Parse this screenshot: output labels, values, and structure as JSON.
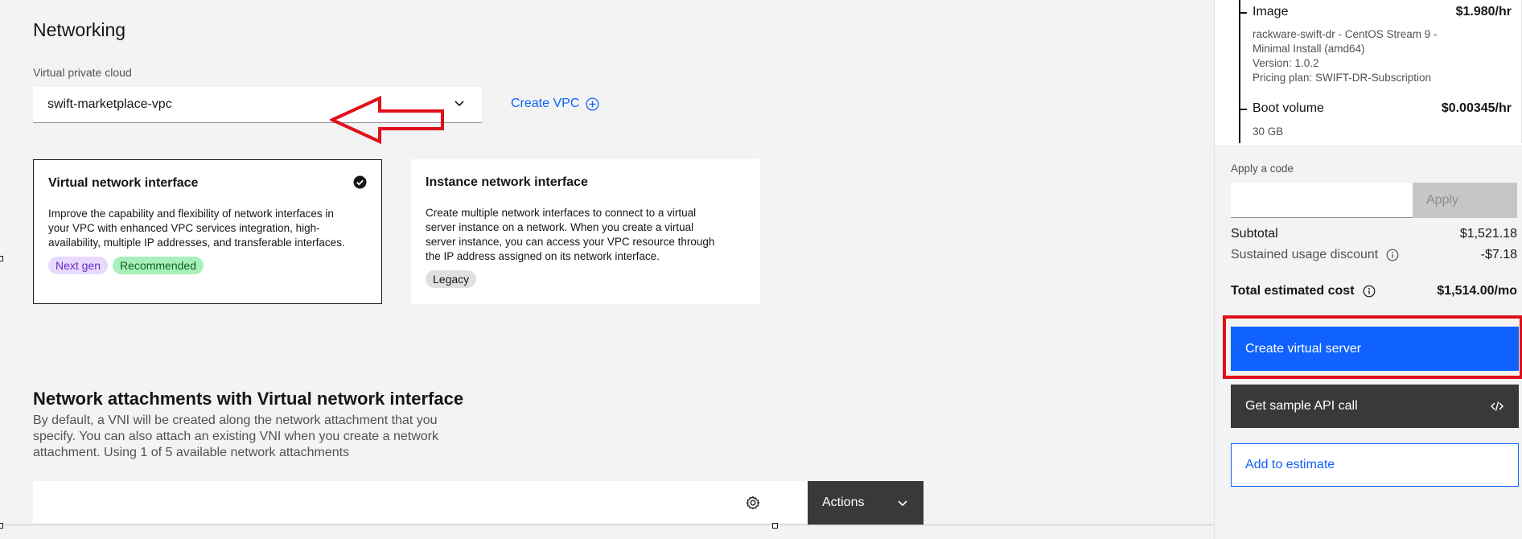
{
  "networking": {
    "title": "Networking",
    "vpc_label": "Virtual private cloud",
    "vpc_value": "swift-marketplace-vpc",
    "create_vpc_label": "Create VPC"
  },
  "tiles": {
    "vni": {
      "title": "Virtual network interface",
      "description": "Improve the capability and flexibility of network interfaces in your VPC with enhanced VPC services integration, high-availability, multiple IP addresses, and transferable interfaces.",
      "tag1": "Next gen",
      "tag2": "Recommended"
    },
    "ini": {
      "title": "Instance network interface",
      "description": "Create multiple network interfaces to connect to a virtual server instance on a network. When you create a virtual server instance, you can access your VPC resource through the IP address assigned on its network interface.",
      "tag1": "Legacy"
    }
  },
  "attachments": {
    "title": "Network attachments with Virtual network interface",
    "description": "By default, a VNI will be created along the network attachment that you specify. You can also attach an existing VNI when you create a network attachment. Using 1 of 5 available network attachments",
    "actions_label": "Actions"
  },
  "summary": {
    "image": {
      "name": "Image",
      "price": "$1.980/hr",
      "line1": "rackware-swift-dr - CentOS Stream 9 -",
      "line2": "Minimal Install (amd64)",
      "line3": "Version: 1.0.2",
      "line4": "Pricing plan: SWIFT-DR-Subscription"
    },
    "boot_volume": {
      "name": "Boot volume",
      "price": "$0.00345/hr",
      "detail": "30 GB"
    },
    "code_label": "Apply a code",
    "apply_label": "Apply",
    "subtotal_label": "Subtotal",
    "subtotal_value": "$1,521.18",
    "discount_label": "Sustained usage discount",
    "discount_value": "-$7.18",
    "total_label": "Total estimated cost",
    "total_value": "$1,514.00/mo",
    "create_label": "Create virtual server",
    "api_label": "Get sample API call",
    "estimate_label": "Add to estimate"
  },
  "colors": {
    "primary": "#0f62fe",
    "annotation_red": "#e0101a",
    "dark_button": "#393939"
  }
}
